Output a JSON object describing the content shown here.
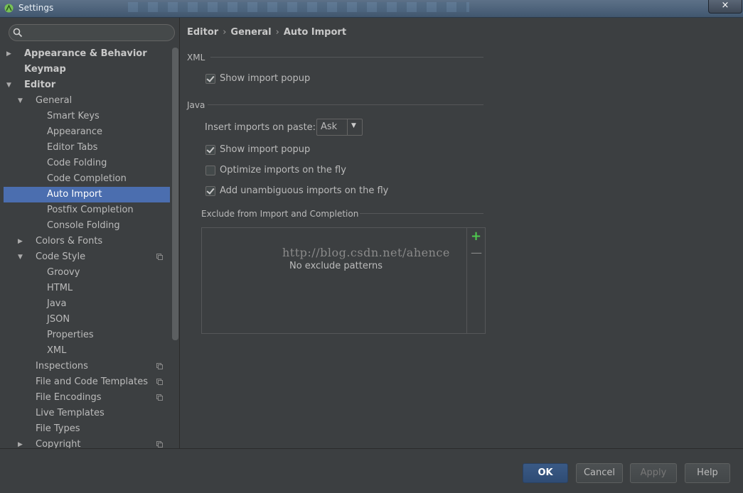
{
  "window": {
    "title": "Settings",
    "close": "×"
  },
  "search": {
    "placeholder": ""
  },
  "tree": [
    {
      "label": "Appearance & Behavior",
      "depth": 0,
      "arrow": "right",
      "bold": true
    },
    {
      "label": "Keymap",
      "depth": 0,
      "arrow": "",
      "bold": true
    },
    {
      "label": "Editor",
      "depth": 0,
      "arrow": "down",
      "bold": true
    },
    {
      "label": "General",
      "depth": 1,
      "arrow": "down"
    },
    {
      "label": "Smart Keys",
      "depth": 2
    },
    {
      "label": "Appearance",
      "depth": 2
    },
    {
      "label": "Editor Tabs",
      "depth": 2
    },
    {
      "label": "Code Folding",
      "depth": 2
    },
    {
      "label": "Code Completion",
      "depth": 2
    },
    {
      "label": "Auto Import",
      "depth": 2,
      "selected": true
    },
    {
      "label": "Postfix Completion",
      "depth": 2
    },
    {
      "label": "Console Folding",
      "depth": 2
    },
    {
      "label": "Colors & Fonts",
      "depth": 1,
      "arrow": "right"
    },
    {
      "label": "Code Style",
      "depth": 1,
      "arrow": "down",
      "project": true
    },
    {
      "label": "Groovy",
      "depth": 2
    },
    {
      "label": "HTML",
      "depth": 2
    },
    {
      "label": "Java",
      "depth": 2
    },
    {
      "label": "JSON",
      "depth": 2
    },
    {
      "label": "Properties",
      "depth": 2
    },
    {
      "label": "XML",
      "depth": 2
    },
    {
      "label": "Inspections",
      "depth": 1,
      "project": true
    },
    {
      "label": "File and Code Templates",
      "depth": 1,
      "project": true
    },
    {
      "label": "File Encodings",
      "depth": 1,
      "project": true
    },
    {
      "label": "Live Templates",
      "depth": 1
    },
    {
      "label": "File Types",
      "depth": 1
    },
    {
      "label": "Copyright",
      "depth": 1,
      "arrow": "right",
      "project": true
    }
  ],
  "breadcrumb": {
    "part1": "Editor",
    "part2": "General",
    "part3": "Auto Import",
    "sep": "›"
  },
  "xml": {
    "section": "XML",
    "show_popup": {
      "label": "Show import popup",
      "checked": true
    }
  },
  "java": {
    "section": "Java",
    "insert_label": "Insert imports on paste:",
    "insert_value": "Ask",
    "show_popup": {
      "label": "Show import popup",
      "checked": true
    },
    "optimize": {
      "label": "Optimize imports on the fly",
      "checked": false
    },
    "unambiguous": {
      "label": "Add unambiguous imports on the fly",
      "checked": true
    }
  },
  "exclude": {
    "section": "Exclude from Import and Completion",
    "empty": "No exclude patterns",
    "add": "+",
    "remove": "—"
  },
  "watermark": "http://blog.csdn.net/ahence",
  "buttons": {
    "ok": "OK",
    "cancel": "Cancel",
    "apply": "Apply",
    "help": "Help"
  }
}
